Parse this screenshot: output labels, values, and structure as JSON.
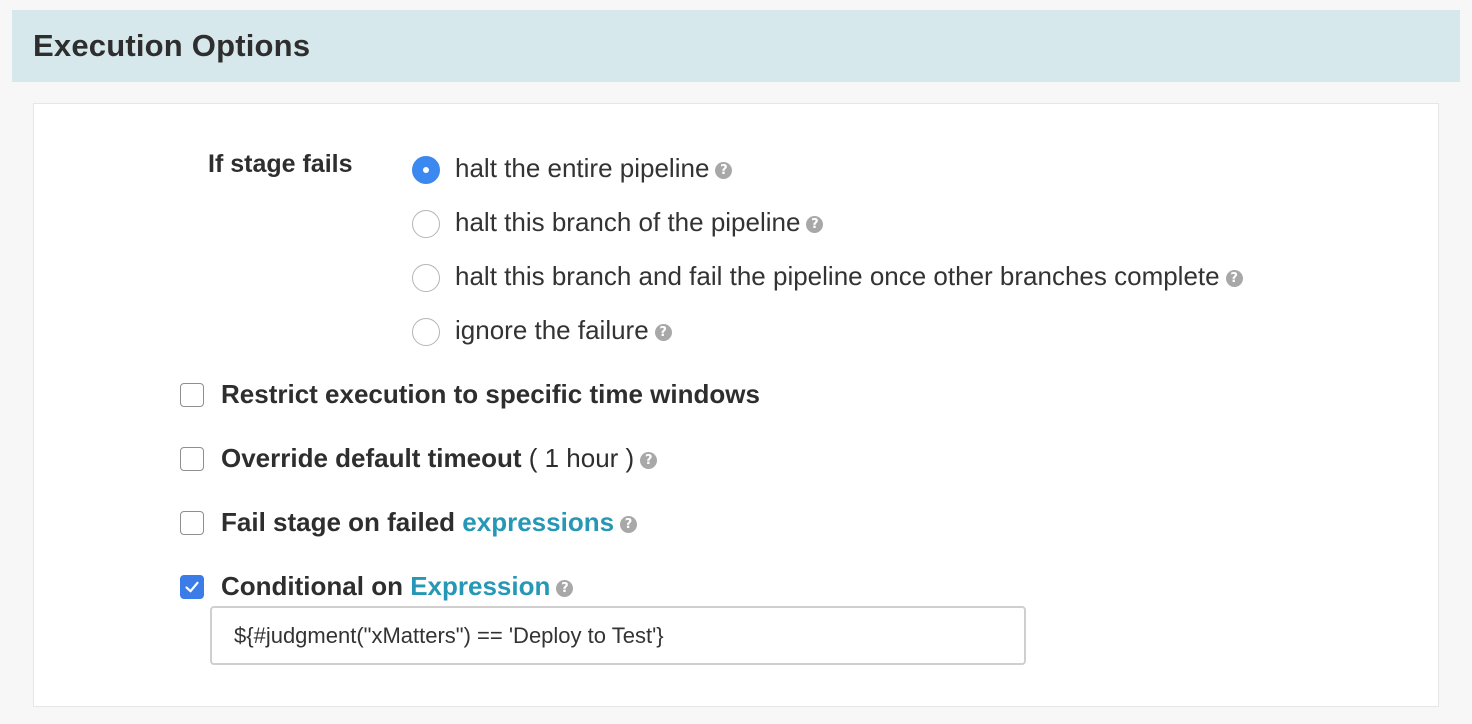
{
  "header": {
    "title": "Execution Options"
  },
  "stage_fail": {
    "label": "If stage fails",
    "options": [
      {
        "label": "halt the entire pipeline",
        "checked": true,
        "help_icon": "question-circle-icon"
      },
      {
        "label": "halt this branch of the pipeline",
        "checked": false,
        "help_icon": "question-circle-icon"
      },
      {
        "label": "halt this branch and fail the pipeline once other branches complete",
        "checked": false,
        "help_icon": "question-circle-icon"
      },
      {
        "label": "ignore the failure",
        "checked": false,
        "help_icon": "question-circle-icon"
      }
    ]
  },
  "restrict_windows": {
    "label": "Restrict execution to specific time windows",
    "checked": false
  },
  "override_timeout": {
    "label": "Override default timeout",
    "detail": "( 1 hour )",
    "checked": false
  },
  "fail_on_expressions": {
    "label": "Fail stage on failed",
    "link": "expressions",
    "checked": false
  },
  "conditional": {
    "label": "Conditional on",
    "link": "Expression",
    "checked": true,
    "expression_value": "${#judgment(\"xMatters\") == 'Deploy to Test'}"
  },
  "colors": {
    "header_bg": "#d6e8ec",
    "accent": "#3b88f0",
    "link": "#2698b6"
  }
}
